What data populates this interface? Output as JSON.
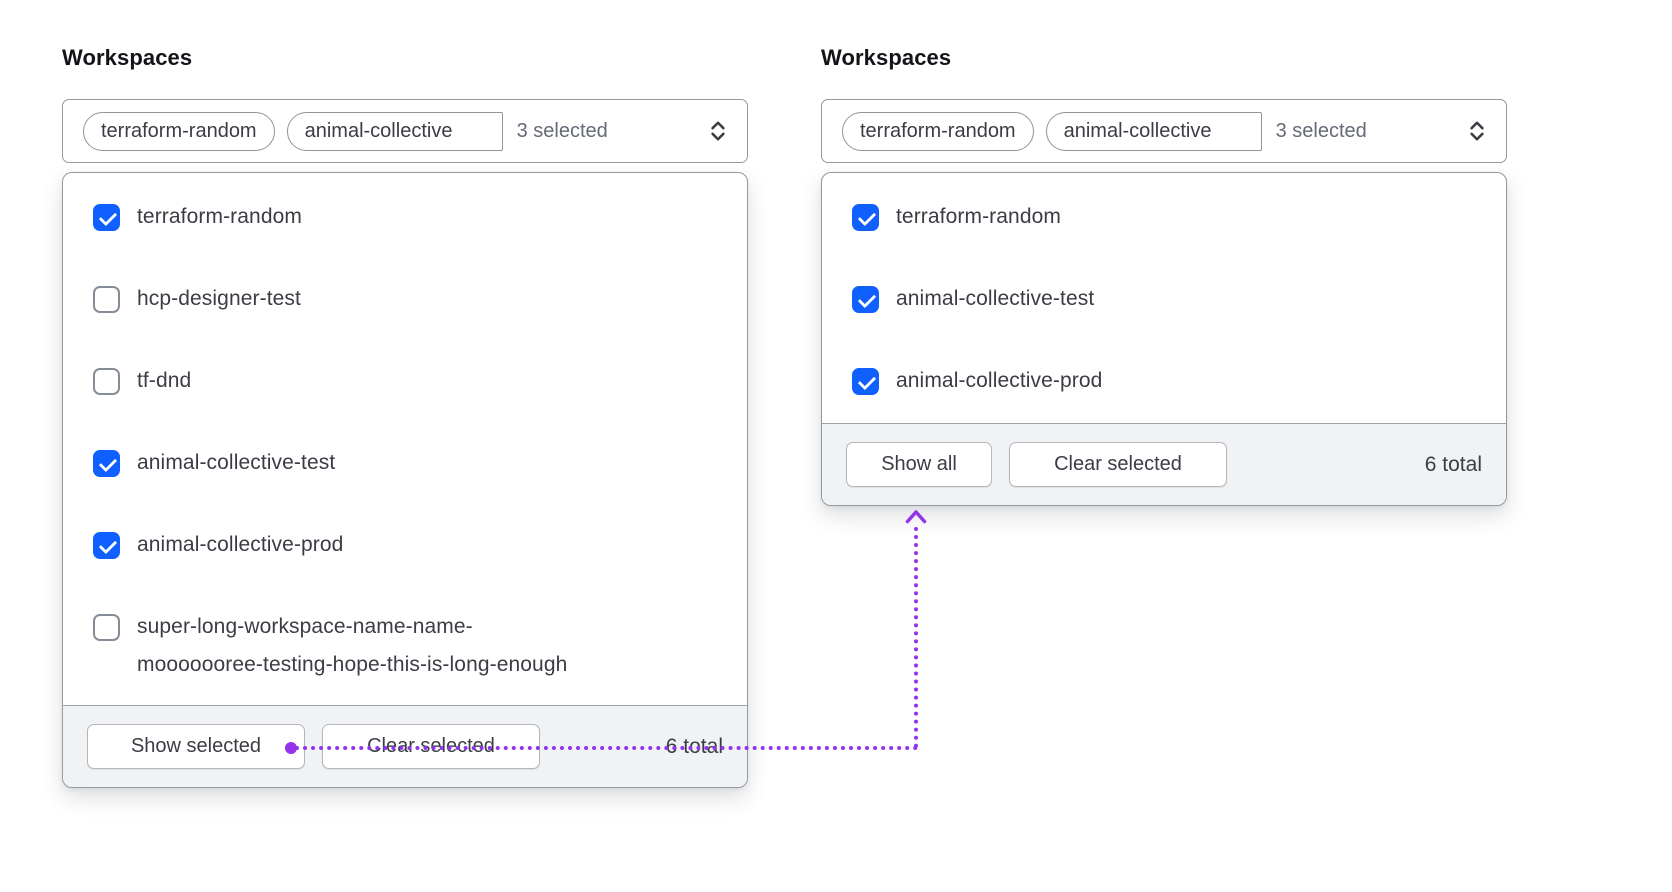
{
  "left": {
    "label": "Workspaces",
    "trigger": {
      "tags": [
        "terraform-random",
        "animal-collective"
      ],
      "count_text": "3 selected"
    },
    "items": [
      {
        "label": "terraform-random",
        "checked": true
      },
      {
        "label": "hcp-designer-test",
        "checked": false
      },
      {
        "label": "tf-dnd",
        "checked": false
      },
      {
        "label": "animal-collective-test",
        "checked": true
      },
      {
        "label": "animal-collective-prod",
        "checked": true
      },
      {
        "label": "super-long-workspace-name-name-mooooooree-testing-hope-this-is-long-enough",
        "checked": false
      }
    ],
    "footer": {
      "primary": "Show selected",
      "secondary": "Clear selected",
      "total": "6 total"
    }
  },
  "right": {
    "label": "Workspaces",
    "trigger": {
      "tags": [
        "terraform-random",
        "animal-collective"
      ],
      "count_text": "3 selected"
    },
    "items": [
      {
        "label": "terraform-random",
        "checked": true
      },
      {
        "label": "animal-collective-test",
        "checked": true
      },
      {
        "label": "animal-collective-prod",
        "checked": true
      }
    ],
    "footer": {
      "primary": "Show all",
      "secondary": "Clear selected",
      "total": "6 total"
    }
  },
  "annotation": {
    "color": "#9333ea",
    "checkbox_checked_color": "#1060ff"
  }
}
